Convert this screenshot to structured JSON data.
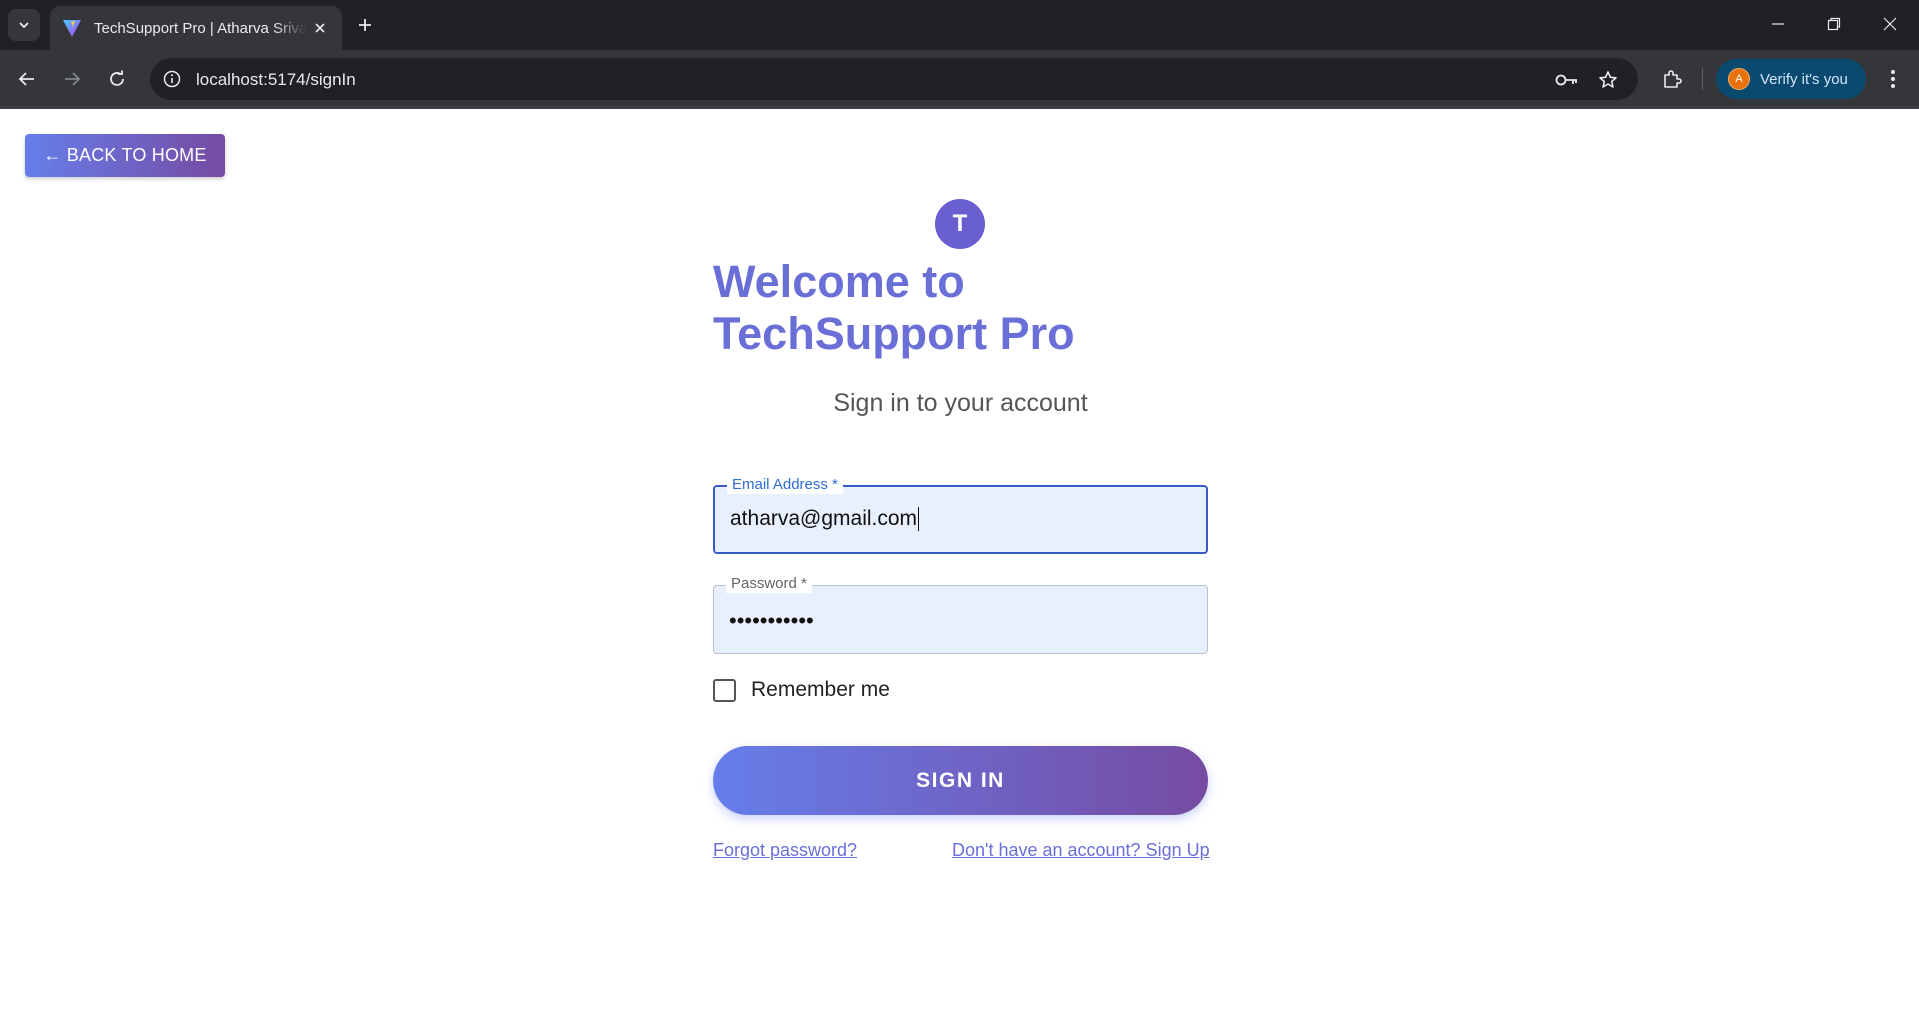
{
  "browser": {
    "tab_title": "TechSupport Pro | Atharva Srivastava",
    "url": "localhost:5174/signIn",
    "profile_button": "Verify it's you",
    "profile_initial": "A"
  },
  "page": {
    "back_button": "← BACK TO HOME",
    "avatar_letter": "T",
    "title": "Welcome to TechSupport Pro",
    "subtitle": "Sign in to your account",
    "email": {
      "label": "Email Address *",
      "value": "atharva@gmail.com"
    },
    "password": {
      "label": "Password *",
      "masked_value": "•••••••••••"
    },
    "remember_me": {
      "label": "Remember me",
      "checked": false
    },
    "signin_button": "SIGN IN",
    "forgot_link": "Forgot password?",
    "signup_link": "Don't have an account? Sign Up"
  },
  "colors": {
    "gradient_start": "#667eea",
    "gradient_end": "#764ba2",
    "title_color": "#6a6fd8",
    "input_bg": "#e8f0fe",
    "focus_border": "#3a5bc7"
  }
}
